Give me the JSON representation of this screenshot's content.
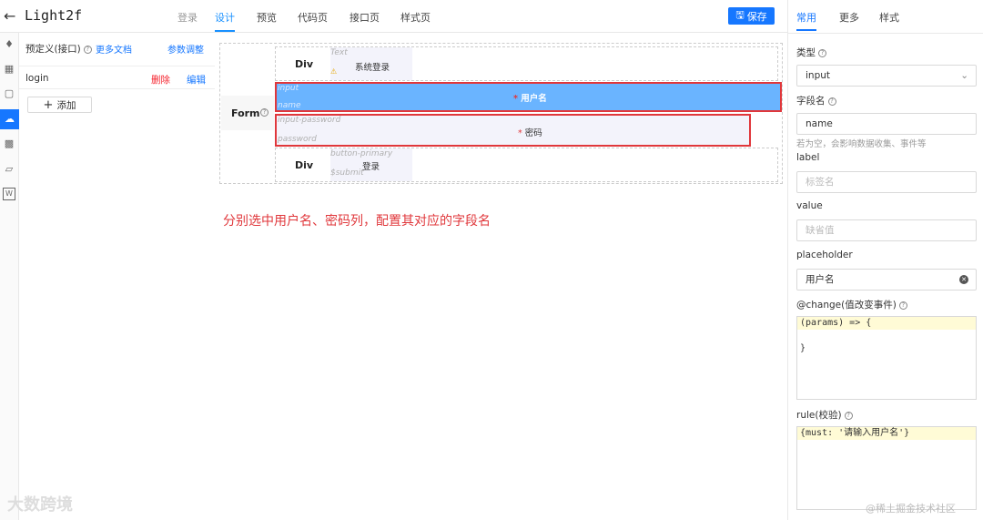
{
  "header": {
    "title": "Light2f",
    "tabs": [
      {
        "label": "登录"
      },
      {
        "label": "设计"
      },
      {
        "label": "预览"
      },
      {
        "label": "代码页"
      },
      {
        "label": "接口页"
      },
      {
        "label": "样式页"
      }
    ],
    "save_label": "保存"
  },
  "rail": {
    "icons": [
      "puzzle-icon",
      "grid-icon",
      "window-icon",
      "cloud-icon",
      "chart-icon",
      "cube-icon",
      "word-icon"
    ]
  },
  "left_panel": {
    "title": "预定义(接口)",
    "docs_link": "更多文档",
    "param_link": "参数调整",
    "item_name": "login",
    "delete_label": "删除",
    "edit_label": "编辑",
    "add_label": "添加"
  },
  "canvas": {
    "form_label": "Form",
    "row1": {
      "div_label": "Div",
      "ghost_type": "Text",
      "text": "系统登录"
    },
    "username": {
      "ghost_type": "input",
      "ghost_field": "name",
      "label": "用户名"
    },
    "password": {
      "ghost_type": "input-password",
      "ghost_field": "password",
      "label": "密码"
    },
    "row3": {
      "div_label": "Div",
      "ghost_type": "button-primary",
      "ghost_field": "$submit",
      "text": "登录"
    }
  },
  "annotation": "分别选中用户名、密码列，配置其对应的字段名",
  "right_panel": {
    "tabs": [
      {
        "label": "常用"
      },
      {
        "label": "更多"
      },
      {
        "label": "样式"
      }
    ],
    "type_label": "类型",
    "type_value": "input",
    "field_label": "字段名",
    "field_value": "name",
    "field_hint": "若为空，会影响数据收集、事件等",
    "label_label": "label",
    "label_placeholder": "标签名",
    "value_label": "value",
    "value_placeholder": "缺省值",
    "placeholder_label": "placeholder",
    "placeholder_value": "用户名",
    "change_label": "@change(值改变事件)",
    "change_code": [
      "(params) => {",
      "",
      "}"
    ],
    "rule_label": "rule(校验)",
    "rule_code": "{must: '请输入用户名'}"
  },
  "watermarks": {
    "left": "大数跨境",
    "right": "@稀土掘金技术社区"
  }
}
